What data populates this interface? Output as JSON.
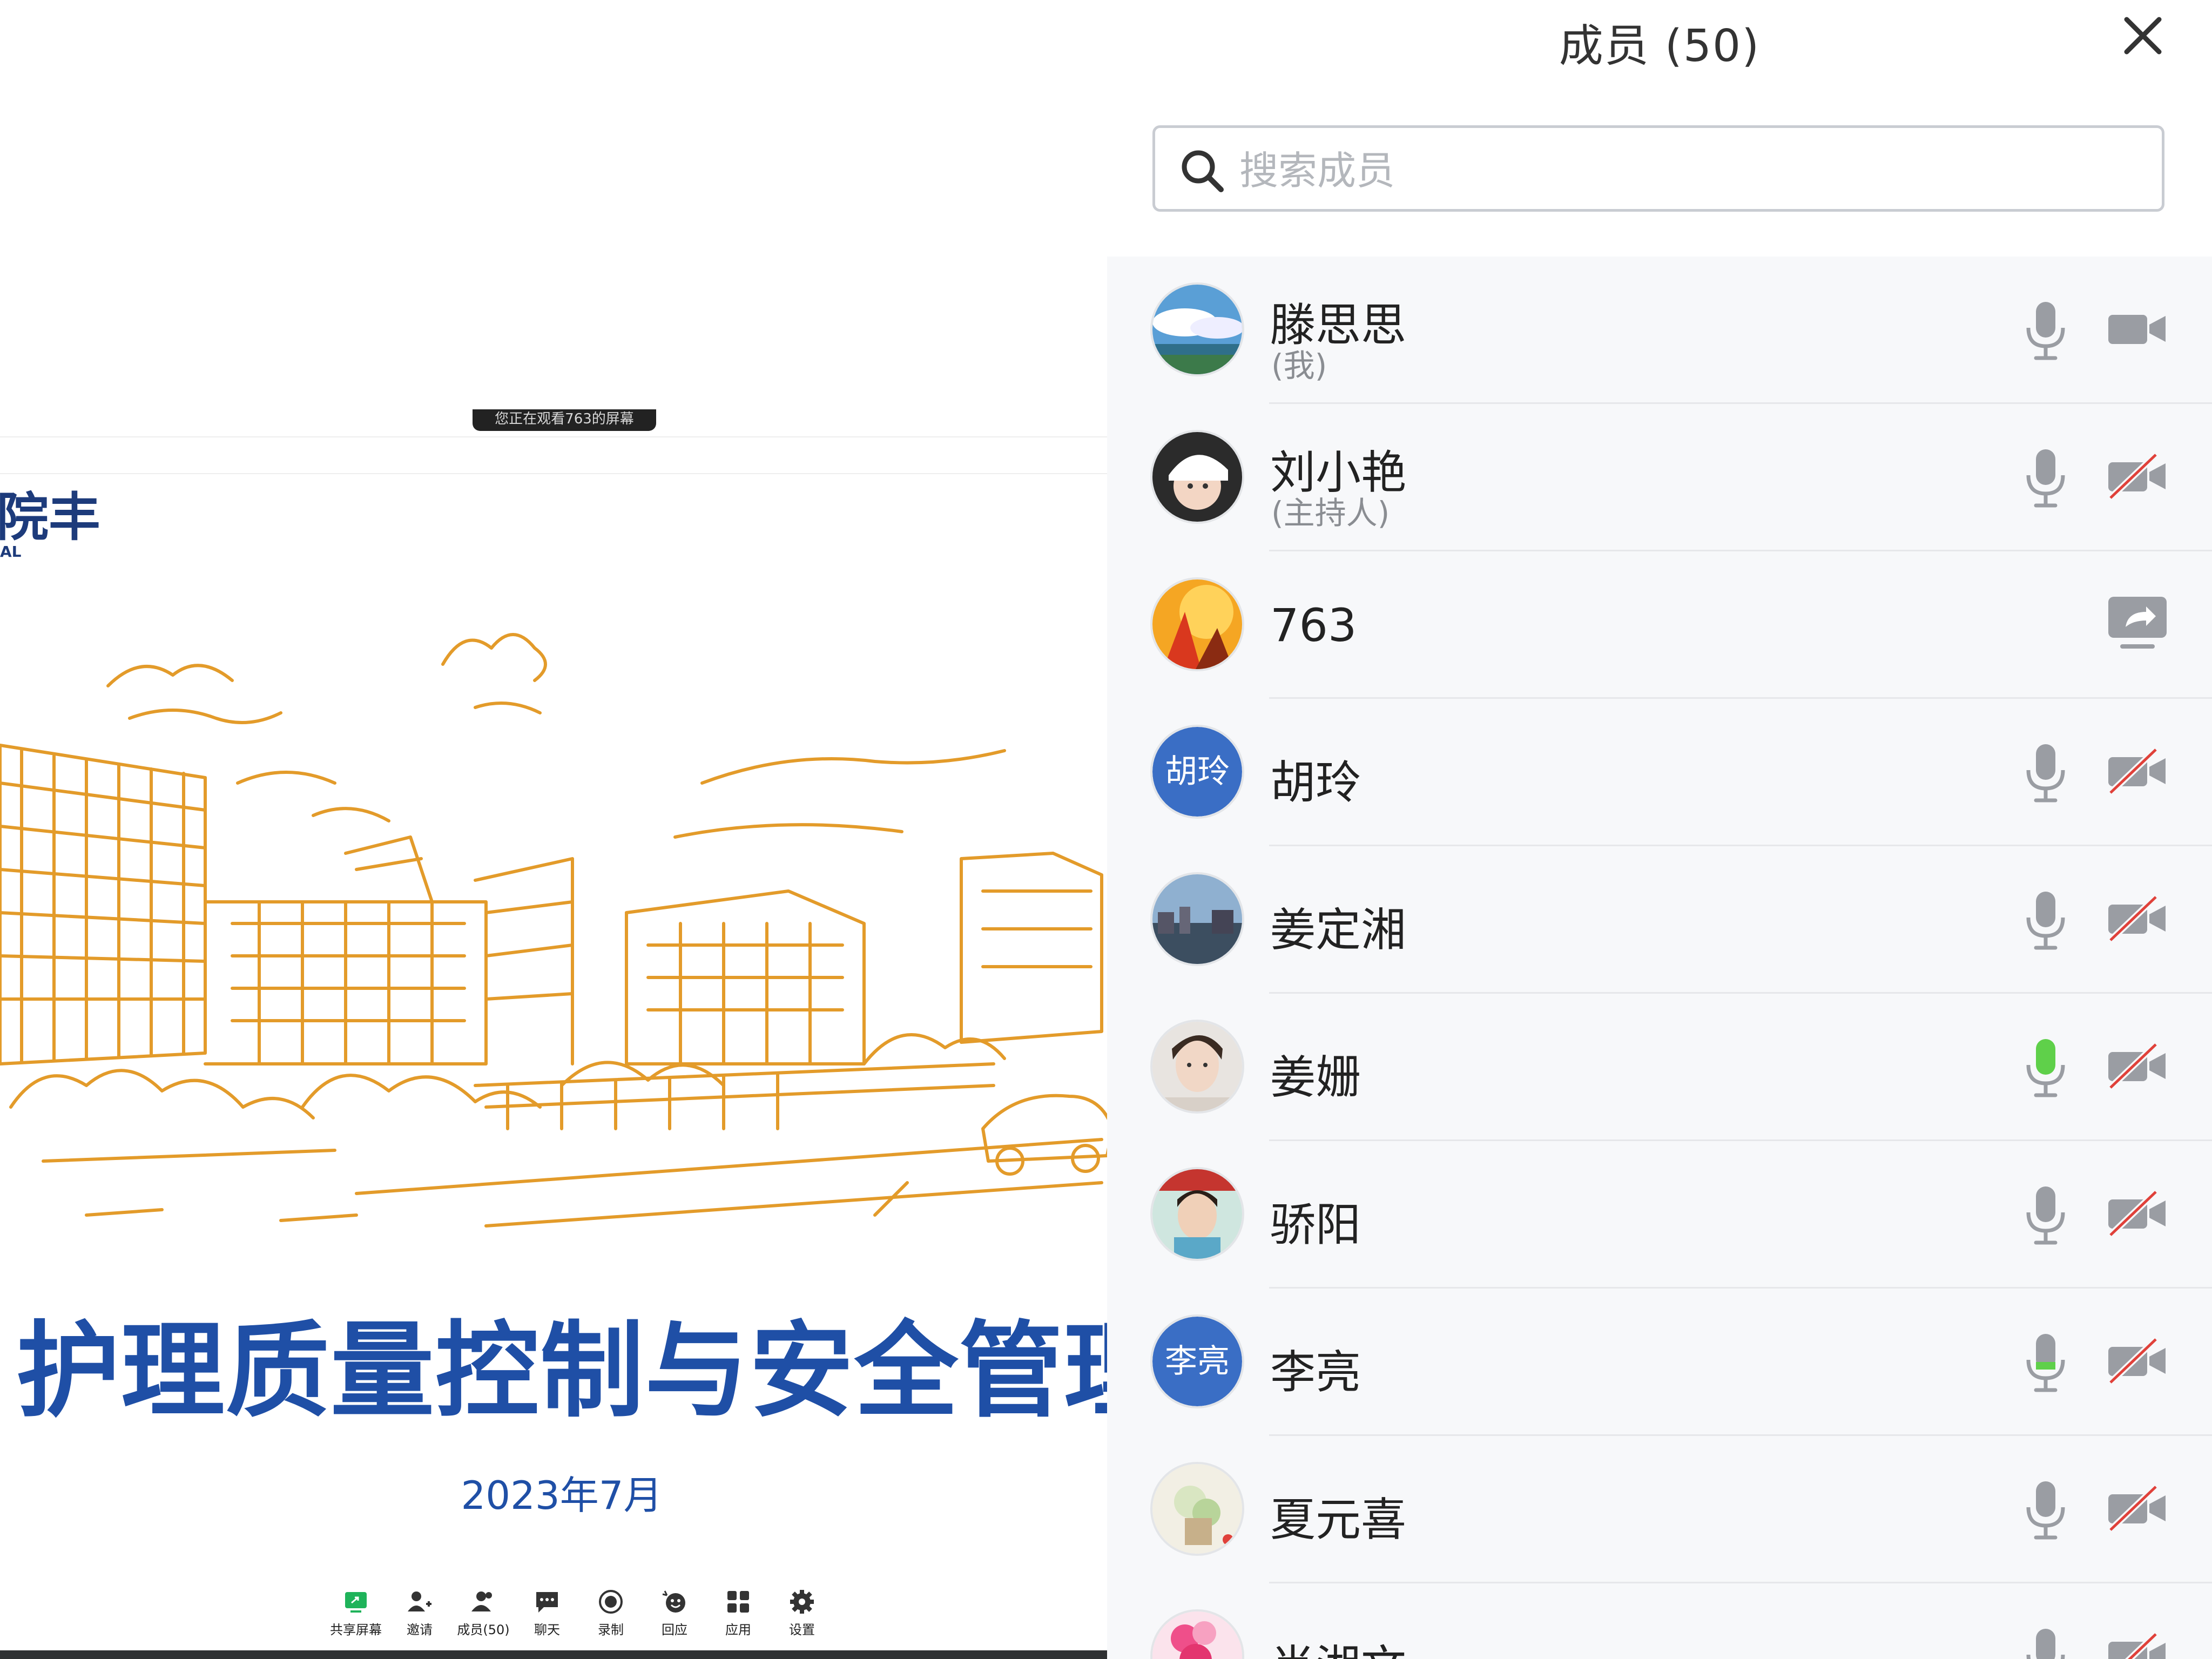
{
  "left_view": {
    "watch_banner": "您正在观看763的屏幕",
    "logo_fragment": "院丰",
    "logo_fragment_sub": "AL",
    "slide_title": "护理质量控制与安全管理",
    "slide_date": "2023年7月",
    "toolbar": [
      {
        "label": "共享屏幕",
        "icon": "share-screen-icon"
      },
      {
        "label": "邀请",
        "icon": "invite-icon"
      },
      {
        "label": "成员(50)",
        "icon": "members-icon"
      },
      {
        "label": "聊天",
        "icon": "chat-icon"
      },
      {
        "label": "录制",
        "icon": "record-icon"
      },
      {
        "label": "回应",
        "icon": "reaction-icon"
      },
      {
        "label": "应用",
        "icon": "apps-icon"
      },
      {
        "label": "设置",
        "icon": "settings-icon"
      }
    ],
    "sketch_color": "#e39b2a"
  },
  "panel": {
    "title": "成员 (50)",
    "search_placeholder": "搜索成员",
    "members": [
      {
        "name": "滕思思",
        "role": "(我)",
        "avatar": "photo-sky",
        "mic": "on",
        "video": "on"
      },
      {
        "name": "刘小艳",
        "role": "(主持人)",
        "avatar": "photo-child",
        "mic": "on",
        "video": "off"
      },
      {
        "name": "763",
        "role": "",
        "avatar": "photo-orange",
        "mic": "none",
        "video": "sharing"
      },
      {
        "name": "胡玲",
        "role": "",
        "avatar_text": "胡玲",
        "mic": "on",
        "video": "off"
      },
      {
        "name": "姜定湘",
        "role": "",
        "avatar": "photo-city",
        "mic": "on",
        "video": "off"
      },
      {
        "name": "姜姗",
        "role": "",
        "avatar": "photo-woman",
        "mic": "speaking",
        "video": "off"
      },
      {
        "name": "骄阳",
        "role": "",
        "avatar": "photo-man",
        "mic": "on",
        "video": "off"
      },
      {
        "name": "李亮",
        "role": "",
        "avatar_text": "李亮",
        "mic": "low",
        "video": "off"
      },
      {
        "name": "夏元喜",
        "role": "",
        "avatar": "photo-flowers",
        "mic": "on",
        "video": "off"
      },
      {
        "name": "肖湘文",
        "role": "",
        "avatar": "photo-pink",
        "mic": "on",
        "video": "off"
      }
    ],
    "colors": {
      "accent": "#3a6ec5",
      "speaking": "#5fd04a",
      "muted_slash": "#e0413a",
      "icon_gray": "#9a9da3"
    }
  }
}
